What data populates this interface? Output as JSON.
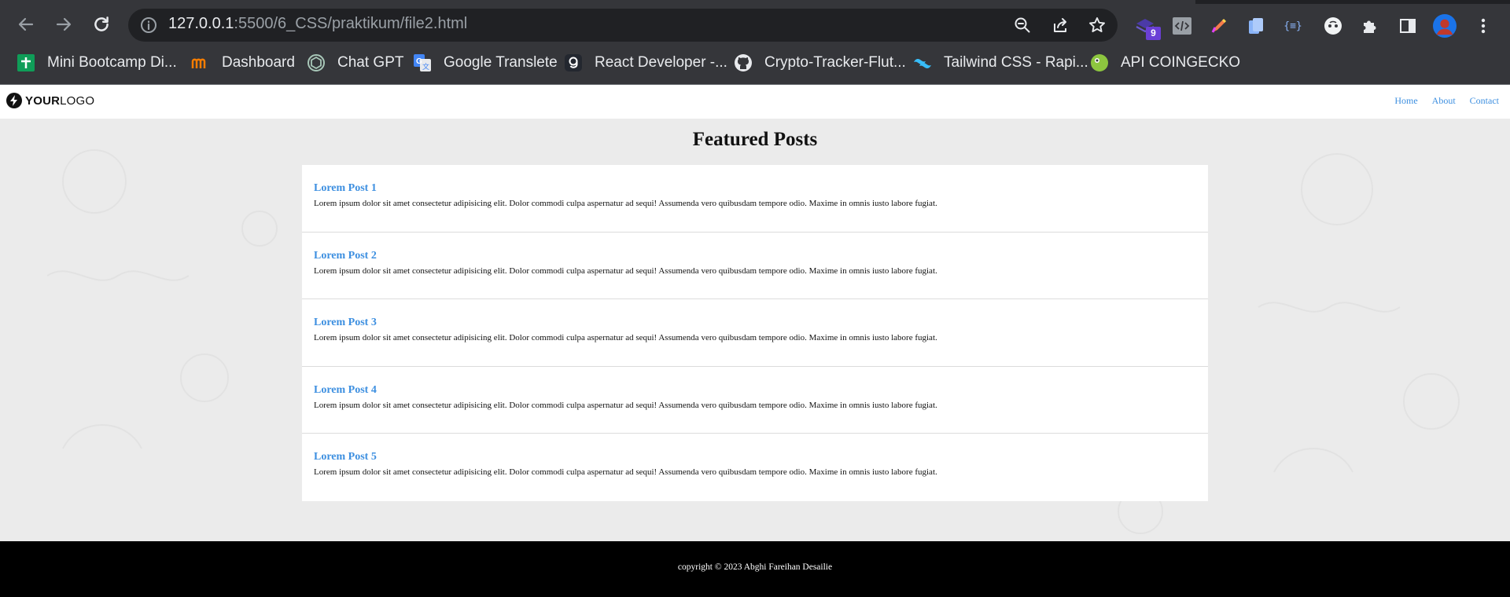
{
  "browser": {
    "url_host": "127.0.0.1",
    "url_path": ":5500/6_CSS/praktikum/file2.html",
    "extension_badge": "9",
    "bookmarks": [
      {
        "label": "Mini Bootcamp Di...",
        "icon": "google-sheets-icon"
      },
      {
        "label": "Dashboard",
        "icon": "dashboard-icon"
      },
      {
        "label": "Chat GPT",
        "icon": "chatgpt-icon"
      },
      {
        "label": "Google Translete",
        "icon": "google-translate-icon"
      },
      {
        "label": "React Developer -...",
        "icon": "react-dev-icon"
      },
      {
        "label": "Crypto-Tracker-Flut...",
        "icon": "github-icon"
      },
      {
        "label": "Tailwind CSS - Rapi...",
        "icon": "tailwind-icon"
      },
      {
        "label": "API COINGECKO",
        "icon": "coingecko-icon"
      }
    ]
  },
  "site": {
    "logo_bold": "YOUR",
    "logo_light": "LOGO",
    "nav": [
      "Home",
      "About",
      "Contact"
    ],
    "heading": "Featured Posts",
    "posts": [
      {
        "title": "Lorem Post 1",
        "body": "Lorem ipsum dolor sit amet consectetur adipisicing elit. Dolor commodi culpa aspernatur ad sequi! Assumenda vero quibusdam tempore odio. Maxime in omnis iusto labore fugiat."
      },
      {
        "title": "Lorem Post 2",
        "body": "Lorem ipsum dolor sit amet consectetur adipisicing elit. Dolor commodi culpa aspernatur ad sequi! Assumenda vero quibusdam tempore odio. Maxime in omnis iusto labore fugiat."
      },
      {
        "title": "Lorem Post 3",
        "body": "Lorem ipsum dolor sit amet consectetur adipisicing elit. Dolor commodi culpa aspernatur ad sequi! Assumenda vero quibusdam tempore odio. Maxime in omnis iusto labore fugiat."
      },
      {
        "title": "Lorem Post 4",
        "body": "Lorem ipsum dolor sit amet consectetur adipisicing elit. Dolor commodi culpa aspernatur ad sequi! Assumenda vero quibusdam tempore odio. Maxime in omnis iusto labore fugiat."
      },
      {
        "title": "Lorem Post 5",
        "body": "Lorem ipsum dolor sit amet consectetur adipisicing elit. Dolor commodi culpa aspernatur ad sequi! Assumenda vero quibusdam tempore odio. Maxime in omnis iusto labore fugiat."
      }
    ],
    "footer": "copyright © 2023 Abghi Fareihan Desailie"
  },
  "colors": {
    "link": "#3d8fe0",
    "chrome_bg": "#35363a",
    "omnibox_bg": "#202124",
    "page_bg": "#ebebeb",
    "footer_bg": "#000000"
  }
}
